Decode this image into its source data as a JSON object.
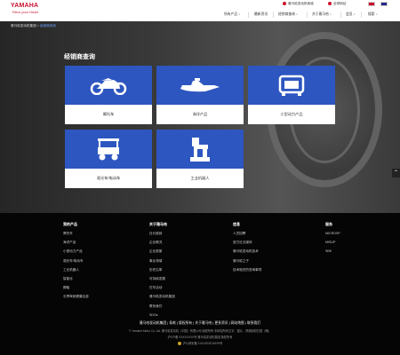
{
  "brand": {
    "name": "YAMAHA",
    "tagline": "Revs your Heart",
    "colors": {
      "brand_red": "#c8102e",
      "card_blue": "#2d56c0",
      "link_blue": "#6aa0ff"
    }
  },
  "header": {
    "util_links": [
      "雅马哈发动机商城",
      "全球网站"
    ],
    "nav": [
      {
        "label": "所有产品",
        "caret": "∨"
      },
      {
        "label": "最新资讯",
        "caret": ""
      },
      {
        "label": "经销商查询",
        "caret": "∨"
      },
      {
        "label": "关于雅马哈",
        "caret": "∨"
      },
      {
        "label": "会员",
        "caret": "∨"
      },
      {
        "label": "搜索",
        "caret": "∨"
      }
    ]
  },
  "breadcrumb": {
    "home": "雅马哈发动机集团",
    "sep": ">",
    "current": "经销商查询"
  },
  "page": {
    "title": "经销商查询"
  },
  "cards": [
    {
      "label": "摩托车",
      "icon": "motorcycle-icon"
    },
    {
      "label": "海洋产品",
      "icon": "jet-ski-icon"
    },
    {
      "label": "小型动力产品",
      "icon": "generator-icon"
    },
    {
      "label": "观光车/电动车",
      "icon": "golf-cart-icon"
    },
    {
      "label": "工业机器人",
      "icon": "robot-arm-icon"
    }
  ],
  "footer": {
    "columns": [
      {
        "heading": "我的产品",
        "items": [
          "摩托车",
          "海洋产品",
          "小型动力产品",
          "观光车/电动车",
          "工业机器人",
          "智能化",
          "脚踏",
          "长青驾驶健康出游"
        ]
      },
      {
        "heading": "关于雅马哈",
        "items": [
          "社长致辞",
          "企业概况",
          "企业愿景",
          "事业领域",
          "历史沿革",
          "可持续发展",
          "在华活动",
          "雅马哈发动机集团",
          "联系我们",
          "SDGs"
        ]
      },
      {
        "heading": "信息",
        "items": [
          "人员招聘",
          "官方社交媒体",
          "雅马哈发动机技术",
          "雅马哈之子",
          "技术相关的咨询事项"
        ]
      },
      {
        "heading": "服务",
        "items": [
          "MICROSP",
          "MISUP",
          "SBK"
        ]
      }
    ],
    "bottom_links": "雅马哈发动机集团 | 条款 | 版权所有 | 关于雅马哈 | 更多资讯 | 网站地图 | 联系我们",
    "copyright_1": "© Yamaha Motor Co.,Ltd. 雅马哈发动机（中国）有限公司 版权所有 本网站所有文字、图片、视频版权归属（略）",
    "copyright_2": "沪ICP备 XXXXXXXX号  雅马哈发动机集团  版权所有",
    "copyright_3": "沪公网安备 31011502016199号"
  }
}
